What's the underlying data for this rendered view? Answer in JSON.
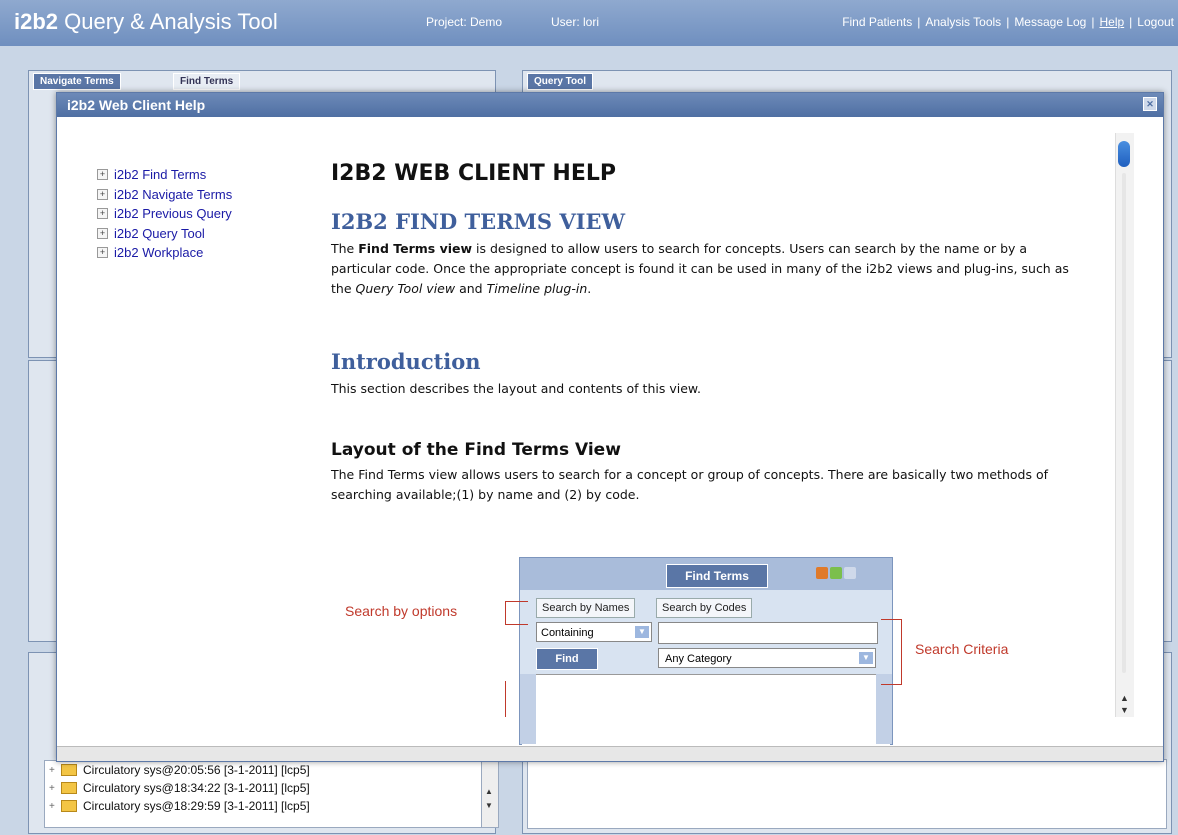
{
  "app": {
    "brand": "i2b2",
    "title": "Query & Analysis Tool",
    "project": "Project: Demo",
    "user": "User: lori"
  },
  "topnav": {
    "items": [
      "Find Patients",
      "Analysis Tools",
      "Message Log",
      "Help",
      "Logout"
    ]
  },
  "background": {
    "tabs": [
      "Navigate Terms",
      "Find Terms"
    ],
    "query_tool_tab": "Query Tool",
    "previous_queries": [
      "Circulatory sys@20:05:56 [3-1-2011] [lcp5]",
      "Circulatory sys@18:34:22 [3-1-2011] [lcp5]",
      "Circulatory sys@18:29:59 [3-1-2011] [lcp5]"
    ]
  },
  "dialog": {
    "title": "i2b2 Web Client Help",
    "toc": [
      "i2b2 Find Terms",
      "i2b2 Navigate Terms",
      "i2b2 Previous Query",
      "i2b2 Query Tool",
      "i2b2 Workplace"
    ],
    "heading": "I2B2 WEB CLIENT HELP",
    "section_title": "I2B2 FIND TERMS VIEW",
    "intro_p": {
      "pre": "The ",
      "bold": "Find Terms view",
      "mid": " is designed to allow users to search for concepts. Users can search by the name or by a particular code. Once the appropriate concept is found it can be used in many of the i2b2 views and plug-ins, such as the ",
      "ital1": "Query Tool view",
      "and": " and ",
      "ital2": "Timeline plug-in",
      "end": "."
    },
    "introduction_title": "Introduction",
    "introduction_text": "This section describes the layout and contents of this view.",
    "layout_title": "Layout of the Find Terms View",
    "layout_text": "The Find Terms view allows users to search for a concept or group of concepts. There are basically two methods of searching available;(1) by name and (2) by code.",
    "figure": {
      "tab": "Find Terms",
      "subtab_names": "Search by Names",
      "subtab_codes": "Search by Codes",
      "select_value": "Containing",
      "find_button": "Find",
      "category_value": "Any Category",
      "annotation_options": "Search by options",
      "annotation_criteria": "Search Criteria"
    }
  }
}
